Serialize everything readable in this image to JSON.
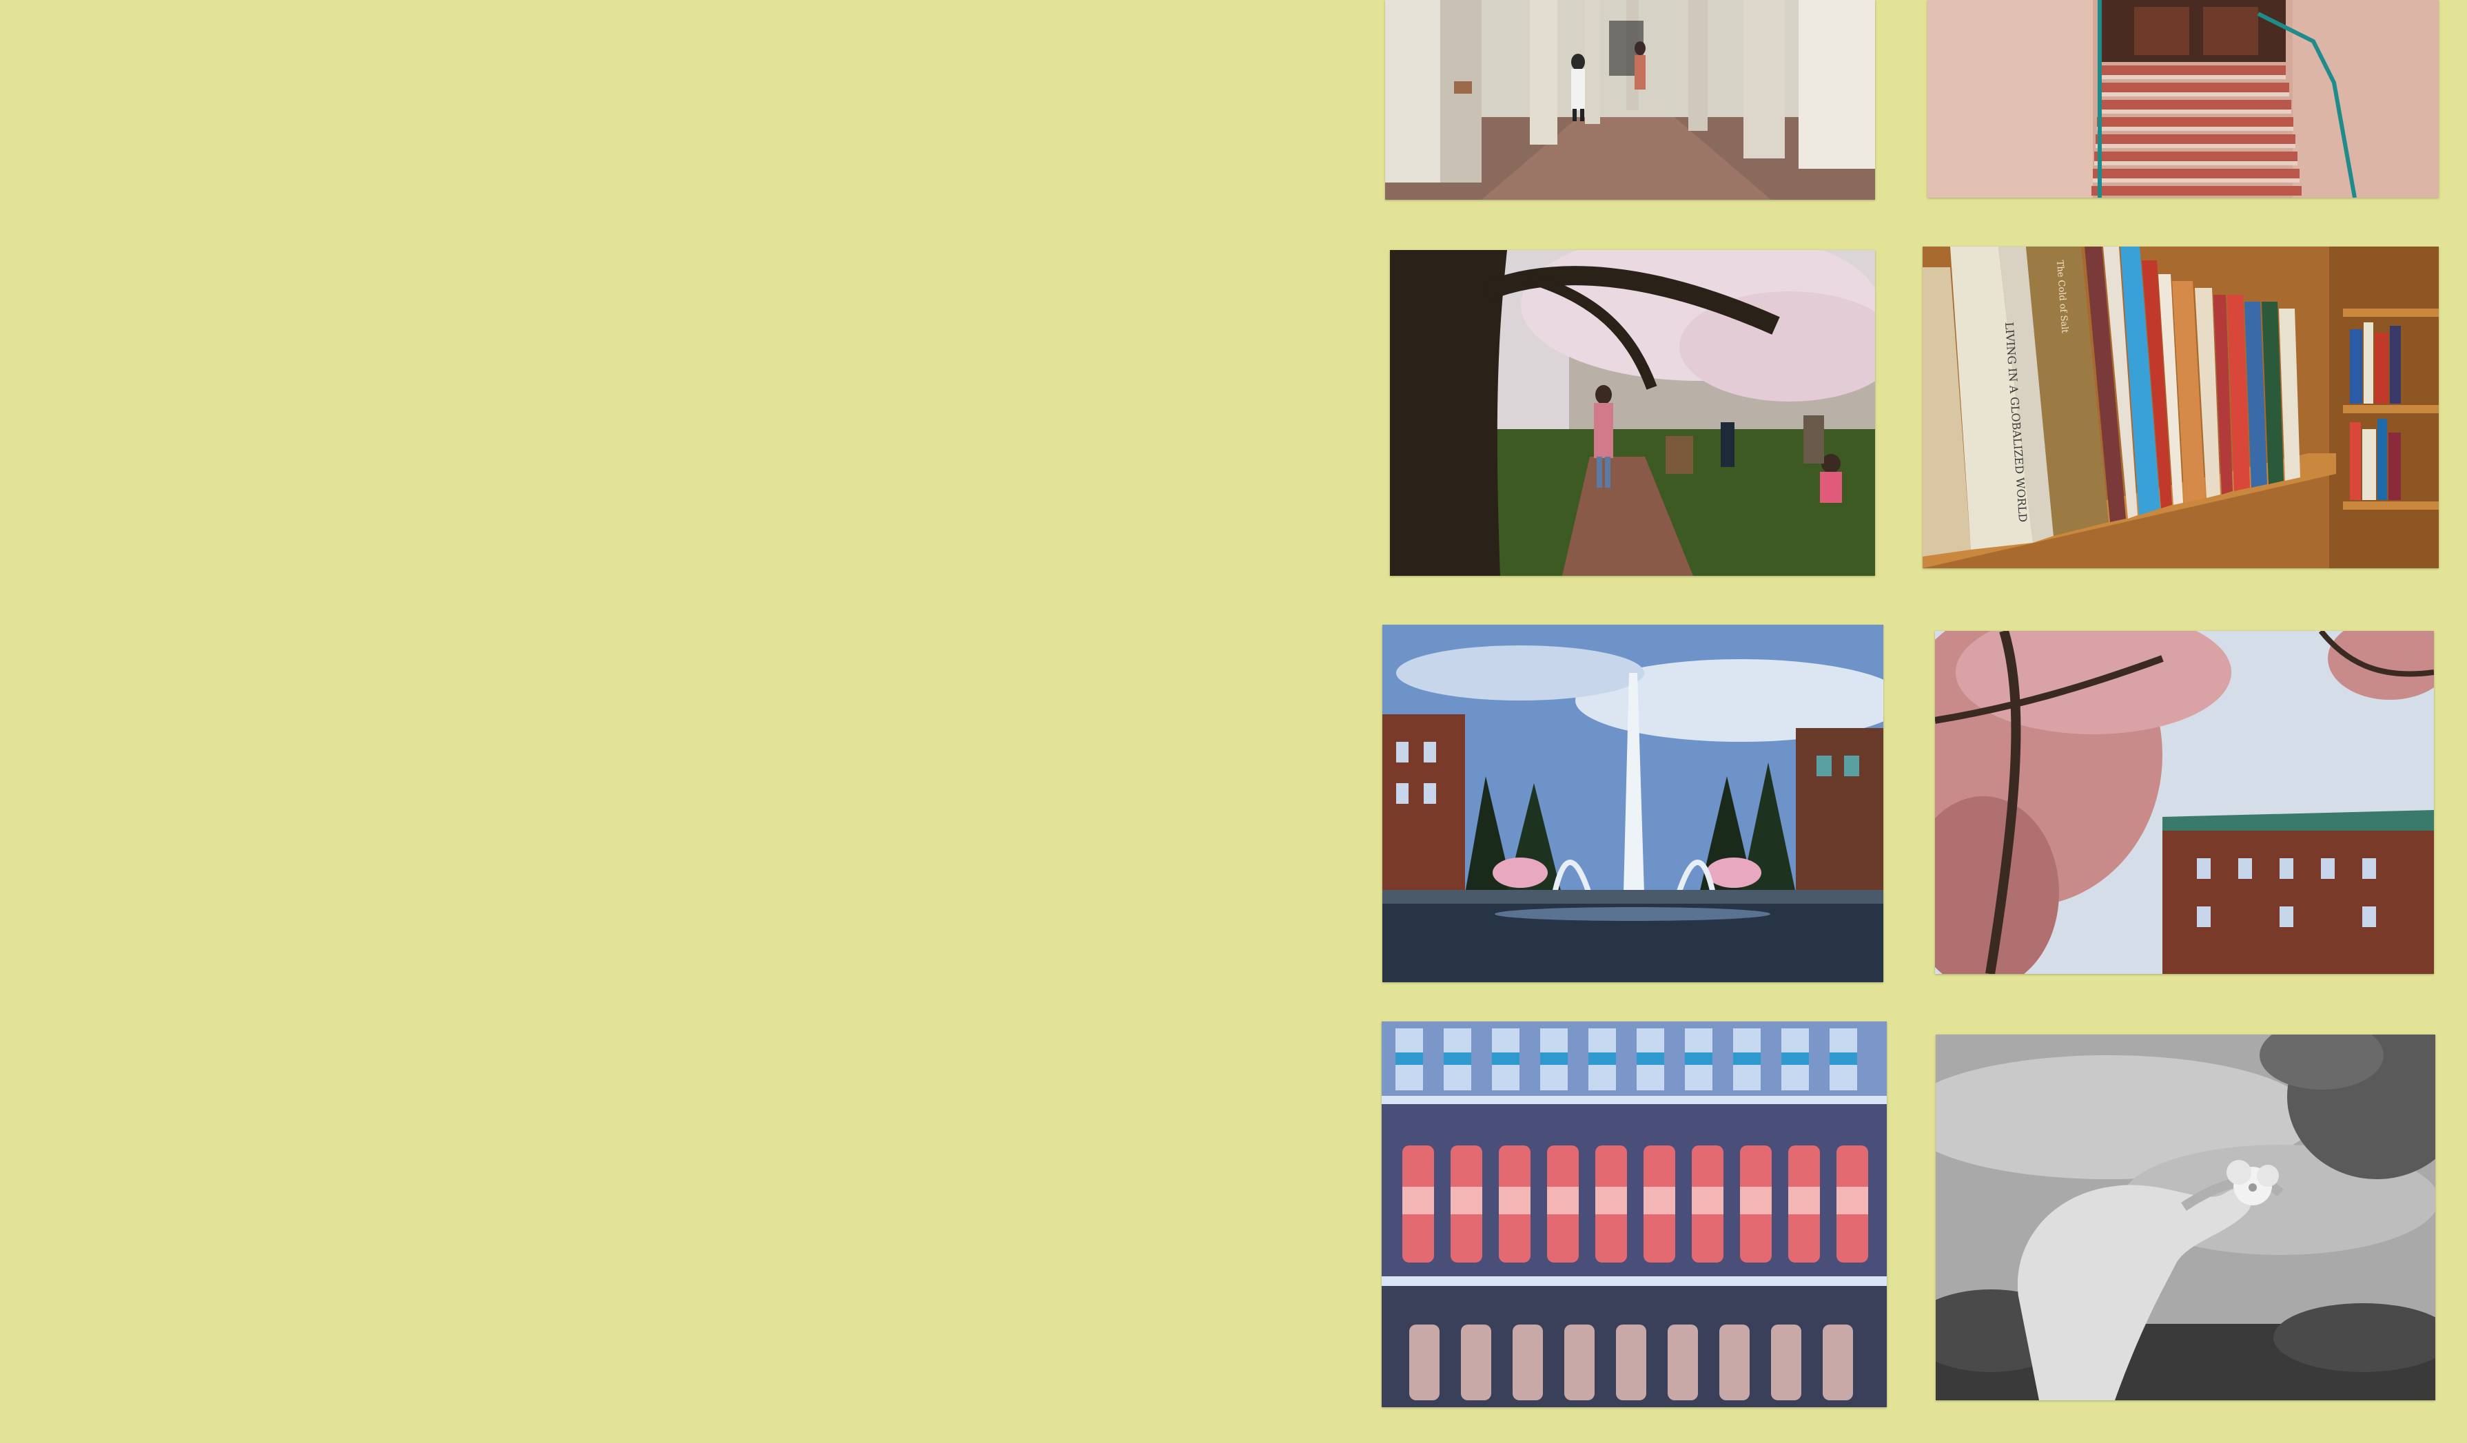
{
  "page": {
    "background": "#e2e397"
  },
  "gallery": {
    "photos": [
      {
        "id": "arcade",
        "name": "covered-walkway-photo",
        "icon": "photo-icon"
      },
      {
        "id": "stairs",
        "name": "brick-stairway-photo",
        "icon": "photo-icon"
      },
      {
        "id": "cherry",
        "name": "cherry-tree-quad-photo",
        "icon": "photo-icon"
      },
      {
        "id": "books",
        "name": "bookshelf-photo",
        "icon": "photo-icon"
      },
      {
        "id": "fountain",
        "name": "fountain-photo",
        "icon": "photo-icon"
      },
      {
        "id": "blossom",
        "name": "blossom-building-photo",
        "icon": "photo-icon"
      },
      {
        "id": "vending",
        "name": "vending-machine-photo",
        "icon": "photo-icon"
      },
      {
        "id": "flower",
        "name": "hand-flower-photo",
        "icon": "photo-icon"
      }
    ],
    "book_spines": [
      "LIVING IN A GLOBALIZED WORLD",
      "The Cold of Salt"
    ]
  }
}
